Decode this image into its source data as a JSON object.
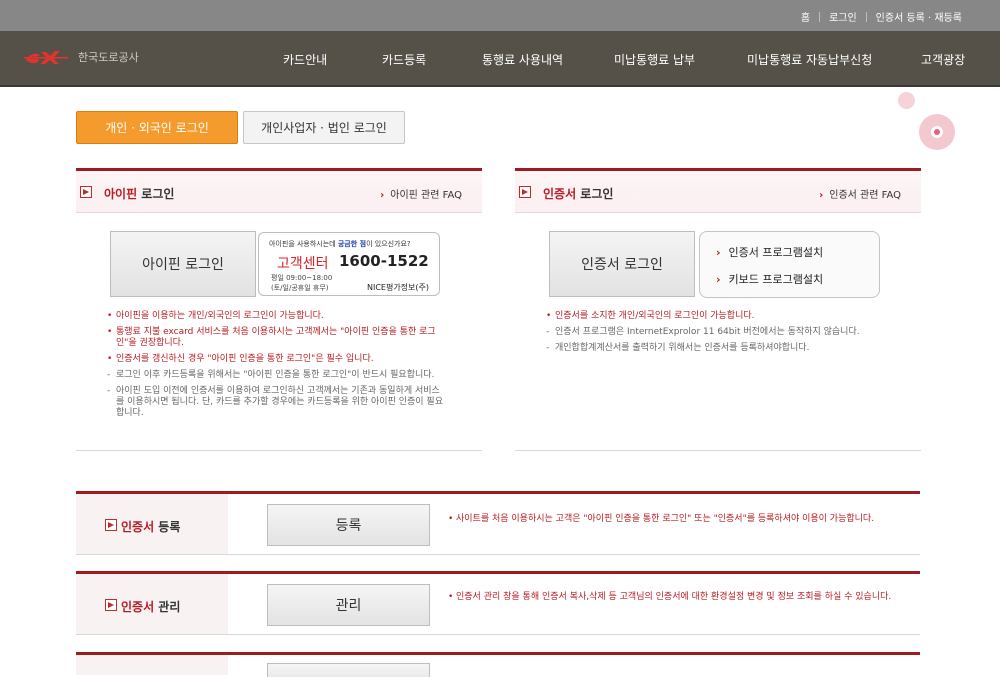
{
  "top_links": [
    "홈",
    "로그인",
    "인증서 등록 · 재등록"
  ],
  "brand": {
    "name": "한국도로공사",
    "accent": "#e5322d"
  },
  "nav": [
    "카드안내",
    "카드등록",
    "통행료 사용내역",
    "미납통행료 납부",
    "미납통행료 자동납부신청",
    "고객광장"
  ],
  "tabs": {
    "personal": "개인 · 외국인 로그인",
    "business": "개인사업자 · 법인 로그인"
  },
  "ipin": {
    "title_red": "아이핀",
    "title_rest": " 로그인",
    "faq": "아이핀 관련 FAQ",
    "button": "아이핀 로그인",
    "help": {
      "question_pre": "아이핀을 사용하시는데 ",
      "question_bold": "궁금한 점",
      "question_post": "이 있으신가요?",
      "center": "고객센터",
      "phone": "1600-1522",
      "hours": "평일 09:00~18:00",
      "holiday": "(토/일/공휴일 휴무)",
      "provider": "NICE평가정보(주)"
    },
    "notes": [
      {
        "type": "red",
        "text": "아이핀을 이용하는 개인/외국인의 로그인이 가능합니다."
      },
      {
        "type": "red",
        "text": "통행료 지불 excard 서비스를 처음 이용하시는 고객께서는 \"아이핀 인증을 통한 로그인\"을 권장합니다."
      },
      {
        "type": "red",
        "text": "인증서를 갱신하신 경우 \"아이핀 인증을 통한 로그인\"은 필수 입니다."
      },
      {
        "type": "gray",
        "text": "로그인 이후 카드등록을 위해서는 \"아이핀 인증을 통한 로그인\"이 반드시 필요합니다."
      },
      {
        "type": "gray",
        "text": "아이핀 도입 이전에 인증서를 이용하여 로그인하신 고객께서는 기존과 동일하게 서비스를 이용하시면 됩니다. 단, 카드를 추가할 경우에는 카드등록을 위한 아이핀 인증이 필요합니다."
      }
    ]
  },
  "cert": {
    "title_red": "인증서",
    "title_rest": " 로그인",
    "faq": "인증서 관련 FAQ",
    "button": "인증서 로그인",
    "programs": [
      "인증서 프로그램설치",
      "키보드 프로그램설치"
    ],
    "notes": [
      {
        "type": "red",
        "text": "인증서를 소지한 개인/외국인의 로그인이 가능합니다."
      },
      {
        "type": "gray",
        "text": "인증서 프로그램은 InternetExprolor 11 64bit 버전에서는 동작하지 않습니다."
      },
      {
        "type": "gray",
        "text": "개인합합계계산서를 출력하기 위해서는 인증서를 등록하셔야합니다."
      }
    ]
  },
  "sections": [
    {
      "title_red": "인증서",
      "title_rest": " 등록",
      "button": "등록",
      "note": "사이트를 처음 이용하시는 고객은 \"아이핀 인증을 통한 로그인\" 또는 \"인증서\"를 등록하셔야 이용이 가능합니다."
    },
    {
      "title_red": "인증서",
      "title_rest": " 관리",
      "button": "관리",
      "note": "인증서 관리 창을 통해 인증서 복사,삭제 등 고객님의 인증서에 대한 환경설정 변경 및 정보 조회를 하실 수 있습니다."
    }
  ]
}
